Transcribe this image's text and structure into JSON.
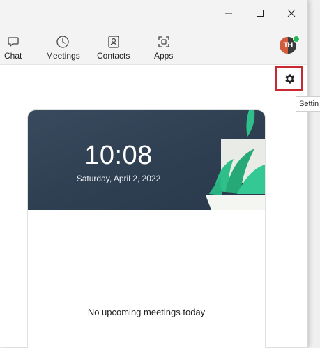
{
  "window": {
    "controls": {
      "minimize": "minimize",
      "maximize": "maximize",
      "close": "close"
    }
  },
  "toolbar": {
    "tabs": [
      {
        "label": "Chat",
        "icon": "chat-bubble-icon"
      },
      {
        "label": "Meetings",
        "icon": "clock-icon"
      },
      {
        "label": "Contacts",
        "icon": "contact-card-icon"
      },
      {
        "label": "Apps",
        "icon": "apps-icon"
      }
    ],
    "avatar": {
      "initials": "TH",
      "status_color": "#20b954"
    }
  },
  "settings": {
    "icon": "gear-icon",
    "tooltip": "Settin",
    "highlight_color": "#c8282f"
  },
  "home_card": {
    "time": "10:08",
    "date": "Saturday, April 2, 2022",
    "empty_message": "No upcoming meetings today",
    "hero_color": "#33445a",
    "plant_color": "#2fbf8a"
  }
}
